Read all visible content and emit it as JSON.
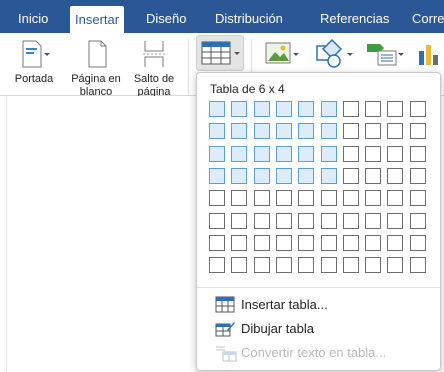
{
  "tabs": [
    {
      "label": "Inicio",
      "active": false
    },
    {
      "label": "Insertar",
      "active": true
    },
    {
      "label": "Diseño",
      "active": false
    },
    {
      "label": "Distribución",
      "active": false
    },
    {
      "label": "Referencias",
      "active": false
    },
    {
      "label": "Corre",
      "active": false
    }
  ],
  "ribbon": {
    "cover_label_1": "Portada",
    "blank_label_1": "Página en",
    "blank_label_2": "blanco",
    "break_label_1": "Salto de",
    "break_label_2": "página",
    "icons": [
      "cover-page-icon",
      "blank-page-icon",
      "page-break-icon",
      "table-icon",
      "pictures-icon",
      "shapes-icon",
      "smartart-icon",
      "chart-icon"
    ]
  },
  "table_menu": {
    "title": "Tabla de 6 x 4",
    "grid_cols": 10,
    "grid_rows": 8,
    "selected_cols": 6,
    "selected_rows": 4,
    "items": [
      {
        "label": "Insertar tabla...",
        "icon": "insert-table-icon",
        "enabled": true
      },
      {
        "label": "Dibujar tabla",
        "icon": "draw-table-icon",
        "enabled": true
      },
      {
        "label": "Convertir texto en tabla...",
        "icon": "convert-text-table-icon",
        "enabled": false
      }
    ]
  },
  "colors": {
    "tab_bar": "#2b5797",
    "selected_cell_fill": "#dcecf9",
    "selected_cell_border": "#5c9fd6",
    "disabled_text": "#b9b9b9"
  }
}
